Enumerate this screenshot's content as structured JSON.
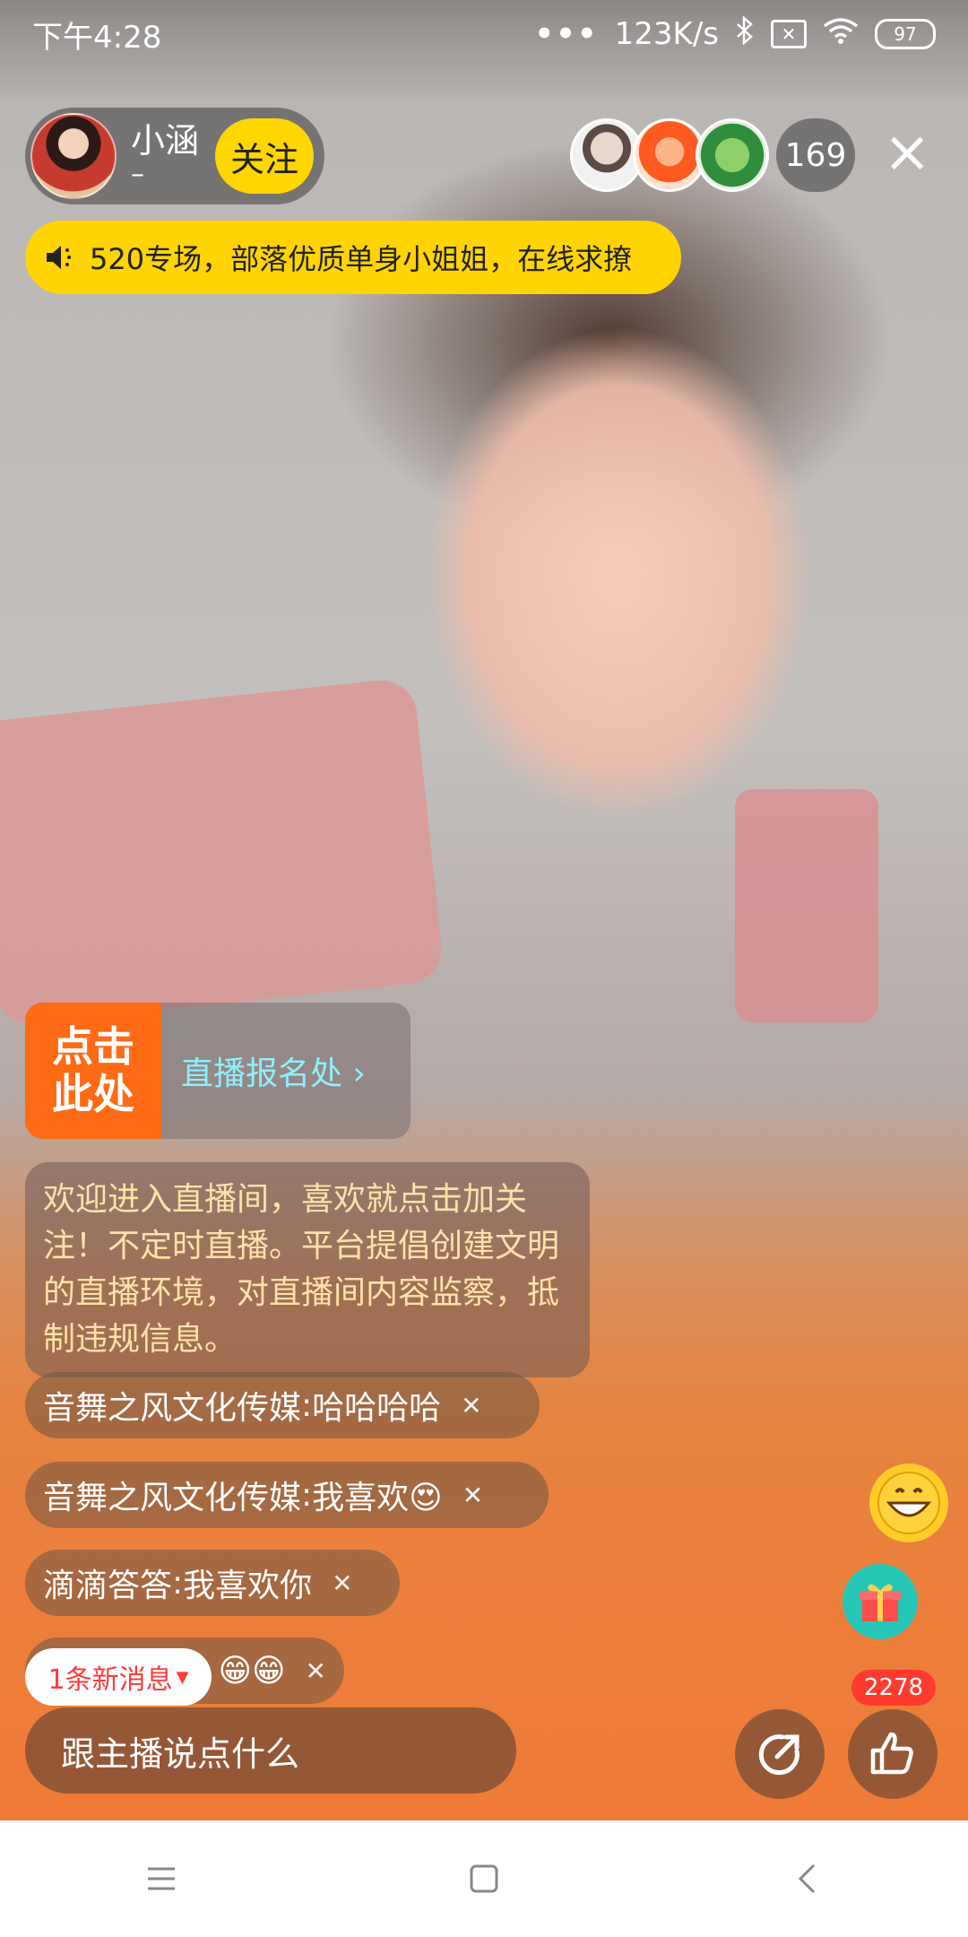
{
  "status_bar": {
    "time": "下午4:28",
    "network_speed": "123K/s",
    "battery": "97",
    "icons": [
      "signal-dots-icon",
      "bluetooth-icon",
      "sim-off-icon",
      "wifi-icon",
      "battery-icon"
    ]
  },
  "host": {
    "name": "小涵",
    "subtitle": "–",
    "follow_label": "关注"
  },
  "viewers": {
    "count": "169"
  },
  "announcement": {
    "text": "520专场，部落优质单身小姐姐，在线求撩"
  },
  "signup_banner": {
    "tag": "点击\n此处",
    "link_text": "直播报名处 ›"
  },
  "system_message": "欢迎进入直播间，喜欢就点击加关注！不定时直播。平台提倡创建文明的直播环境，对直播间内容监察，抵制违规信息。",
  "chat_messages": [
    {
      "user": "音舞之风文化传媒",
      "text": "哈哈哈哈"
    },
    {
      "user": "音舞之风文化传媒",
      "text": "我喜欢😍"
    },
    {
      "user": "滴滴答答",
      "text": "我喜欢你"
    },
    {
      "user": "",
      "text": "😁😁"
    }
  ],
  "new_message_pill": "1条新消息",
  "input": {
    "placeholder": "跟主播说点什么"
  },
  "likes": {
    "count": "2278"
  },
  "colors": {
    "accent_yellow": "#ffd600",
    "accent_orange": "#ff6a14",
    "like_badge_red": "#ff3b2f",
    "link_cyan": "#8ef0ff"
  }
}
